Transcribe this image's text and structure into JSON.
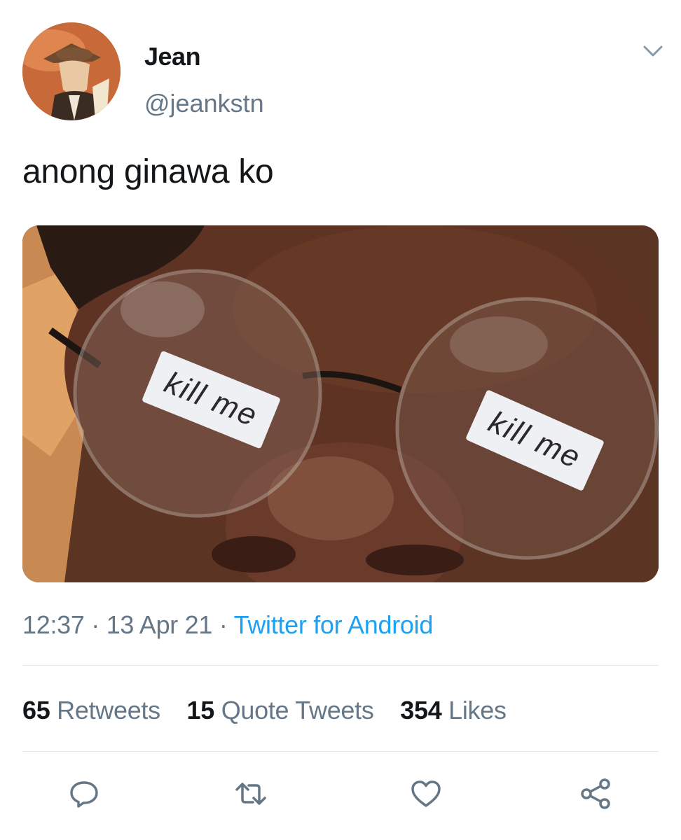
{
  "tweet": {
    "author": {
      "display_name": "Jean",
      "handle": "@jeankstn",
      "avatar_icon": "anime-character-avatar"
    },
    "menu_icon": "chevron-down-icon",
    "text": "anong ginawa ko",
    "media": {
      "lens_text_left": "kill me",
      "lens_text_right": "kill me"
    },
    "meta": {
      "time": "12:37",
      "date": "13 Apr 21",
      "separator": "·",
      "source": "Twitter for Android"
    },
    "stats": {
      "retweets": {
        "count": "65",
        "label": "Retweets"
      },
      "quote_tweets": {
        "count": "15",
        "label": "Quote Tweets"
      },
      "likes": {
        "count": "354",
        "label": "Likes"
      }
    },
    "actions": [
      "reply-icon",
      "retweet-icon",
      "like-icon",
      "share-icon"
    ]
  },
  "colors": {
    "text": "#14171a",
    "secondary": "#657786",
    "link": "#1da1f2",
    "divider": "#e1e8ed"
  }
}
